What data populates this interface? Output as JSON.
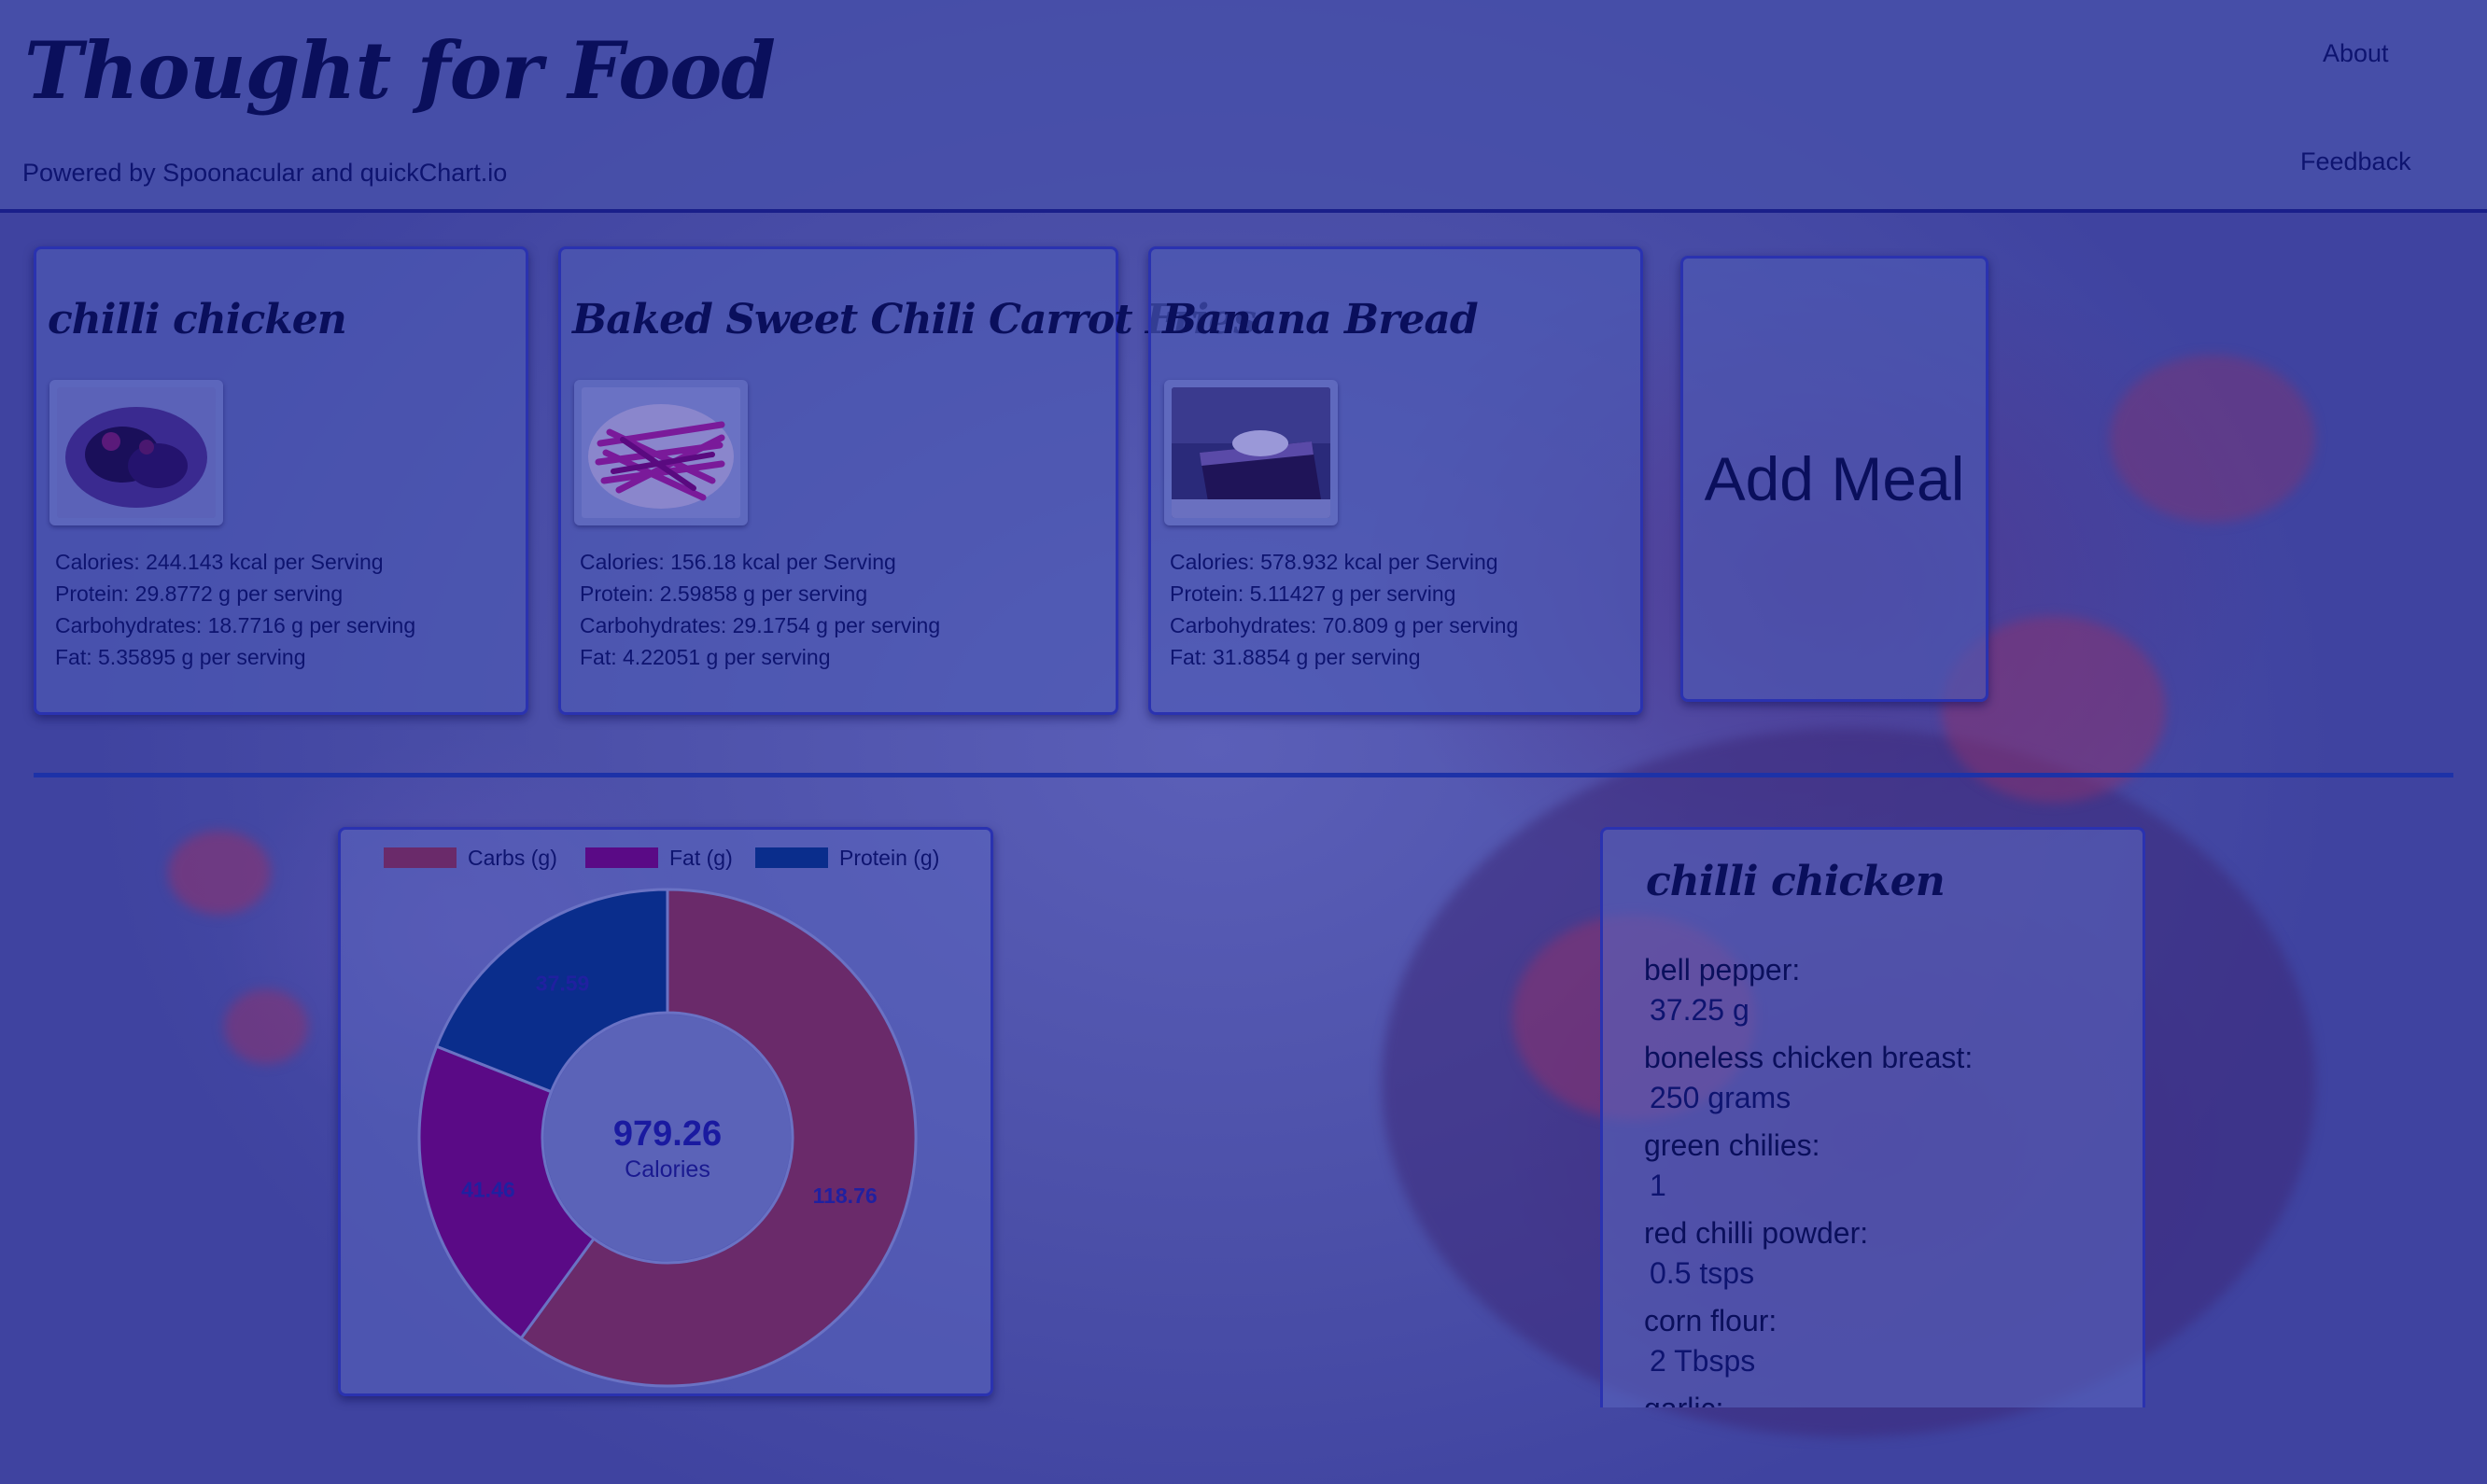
{
  "header": {
    "title": "Thought for Food",
    "powered_by": "Powered by Spoonacular and quickChart.io",
    "nav": {
      "about": "About",
      "feedback": "Feedback"
    }
  },
  "meals": [
    {
      "name": "chilli chicken",
      "calories": "Calories: 244.143 kcal per Serving",
      "protein": "Protein: 29.8772 g per serving",
      "carbs": "Carbohydrates: 18.7716 g per serving",
      "fat": "Fat: 5.35895 g per serving"
    },
    {
      "name": "Baked Sweet Chili Carrot Fries",
      "calories": "Calories: 156.18 kcal per Serving",
      "protein": "Protein: 2.59858 g per serving",
      "carbs": "Carbohydrates: 29.1754 g per serving",
      "fat": "Fat: 4.22051 g per serving"
    },
    {
      "name": "Banana Bread",
      "calories": "Calories: 578.932 kcal per Serving",
      "protein": "Protein: 5.11427 g per serving",
      "carbs": "Carbohydrates: 70.809 g per serving",
      "fat": "Fat: 31.8854 g per serving"
    }
  ],
  "add_meal_label": "Add Meal",
  "chart_data": {
    "type": "pie",
    "variant": "doughnut",
    "categories": [
      "Carbs (g)",
      "Fat (g)",
      "Protein (g)"
    ],
    "values": [
      118.76,
      41.46,
      37.59
    ],
    "colors": [
      "#6a2a6a",
      "#5a0a86",
      "#0a2d8c"
    ],
    "center_value": "979.26",
    "center_label": "Calories",
    "legend_position": "top"
  },
  "ingredients": {
    "title": "chilli chicken",
    "items": [
      {
        "name": "bell pepper",
        "amount": "37.25 g"
      },
      {
        "name": "boneless chicken breast",
        "amount": "250 grams"
      },
      {
        "name": "green chilies",
        "amount": "1"
      },
      {
        "name": "red chilli powder",
        "amount": "0.5 tsps"
      },
      {
        "name": "corn flour",
        "amount": "2 Tbsps"
      },
      {
        "name": "garlic",
        "amount": ""
      }
    ]
  },
  "colors": {
    "header_bg": "#4850aa",
    "card_border": "#2a32b0",
    "text_dark": "#0a0f5c",
    "divider": "#1d32a8"
  }
}
